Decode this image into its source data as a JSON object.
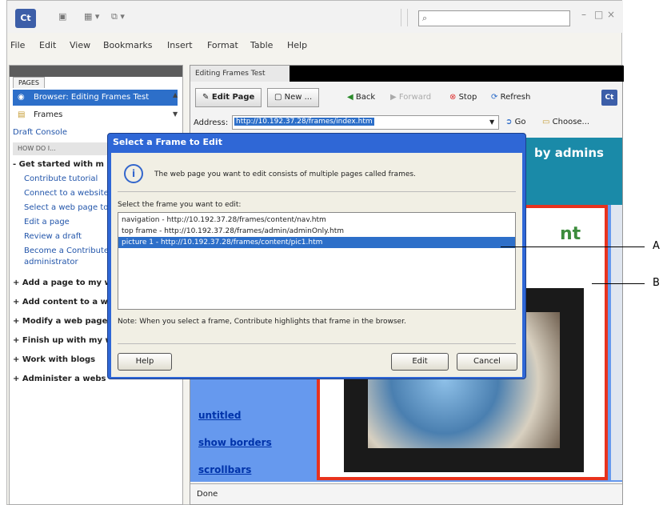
{
  "app": {
    "logo": "Ct",
    "search_glyph": "⌕"
  },
  "menu": [
    "File",
    "Edit",
    "View",
    "Bookmarks",
    "Insert",
    "Format",
    "Table",
    "Help"
  ],
  "left": {
    "pages_label": "PAGES",
    "pages": [
      {
        "label": "Browser: Editing Frames Test",
        "selected": true
      },
      {
        "label": "Frames",
        "selected": false
      }
    ],
    "draft_console": "Draft Console",
    "howdo_label": "HOW DO I...",
    "get_started": "Get started with m",
    "links": [
      "Contribute tutorial",
      "Connect to a website",
      "Select a web page to",
      "Edit a page",
      "Review a draft",
      "Become a Contribute",
      "administrator"
    ],
    "sections": [
      "Add a page to my w",
      "Add content to a w",
      "Modify a web page",
      "Finish up with my w",
      "Work with blogs",
      "Administer a webs"
    ]
  },
  "right": {
    "tab": "Editing Frames Test",
    "edit_page": "Edit Page",
    "new": "New ...",
    "back": "Back",
    "forward": "Forward",
    "stop": "Stop",
    "refresh": "Refresh",
    "logo_small": "Ct",
    "address_label": "Address:",
    "address_value": "http://10.192.37.28/frames/index.htm",
    "go": "Go",
    "choose": "Choose...",
    "banner_text": "by admins",
    "green_text": "nt",
    "page_links": [
      "untitled",
      "show borders",
      "scrollbars"
    ],
    "status": "Done"
  },
  "dialog": {
    "title": "Select a Frame to Edit",
    "message": "The web page you want to edit consists of multiple pages called frames.",
    "select_label": "Select the frame you want to edit:",
    "frames": [
      {
        "label": "navigation - http://10.192.37.28/frames/content/nav.htm",
        "selected": false
      },
      {
        "label": "top frame - http://10.192.37.28/frames/admin/adminOnly.htm",
        "selected": false
      },
      {
        "label": "picture 1 - http://10.192.37.28/frames/content/pic1.htm",
        "selected": true
      }
    ],
    "note": "Note: When you select a frame, Contribute highlights that frame in the browser.",
    "help": "Help",
    "edit": "Edit",
    "cancel": "Cancel"
  },
  "callouts": {
    "a": "A",
    "b": "B"
  }
}
